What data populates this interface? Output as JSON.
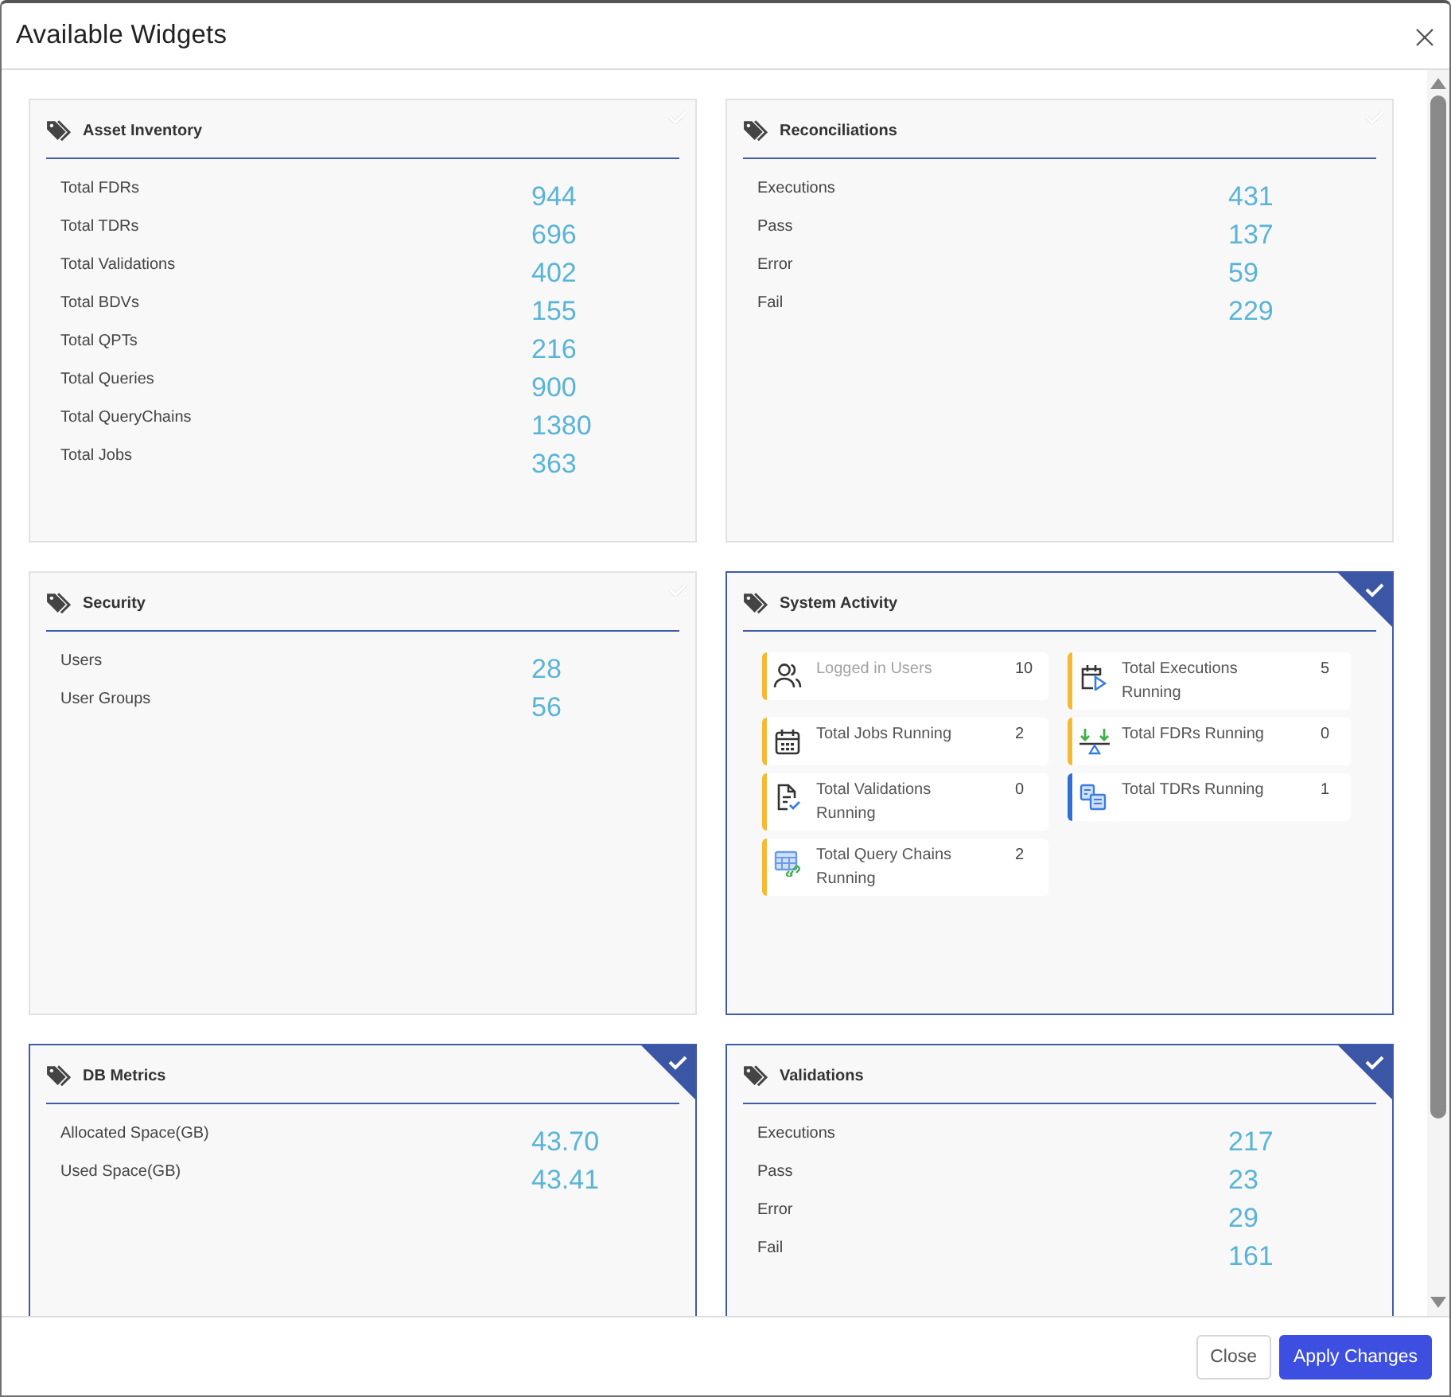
{
  "dialog": {
    "title": "Available Widgets"
  },
  "widgets": [
    {
      "title": "Asset Inventory",
      "selected": false,
      "kind": "stats",
      "rows": [
        {
          "label": "Total FDRs",
          "value": "944"
        },
        {
          "label": "Total TDRs",
          "value": "696"
        },
        {
          "label": "Total Validations",
          "value": "402"
        },
        {
          "label": "Total BDVs",
          "value": "155"
        },
        {
          "label": "Total QPTs",
          "value": "216"
        },
        {
          "label": "Total Queries",
          "value": "900"
        },
        {
          "label": "Total QueryChains",
          "value": "1380"
        },
        {
          "label": "Total Jobs",
          "value": "363"
        }
      ]
    },
    {
      "title": "Reconciliations",
      "selected": false,
      "kind": "stats",
      "rows": [
        {
          "label": "Executions",
          "value": "431"
        },
        {
          "label": "Pass",
          "value": "137"
        },
        {
          "label": "Error",
          "value": "59"
        },
        {
          "label": "Fail",
          "value": "229"
        }
      ]
    },
    {
      "title": "Security",
      "selected": false,
      "kind": "stats",
      "rows": [
        {
          "label": "Users",
          "value": "28"
        },
        {
          "label": "User Groups",
          "value": "56"
        }
      ]
    },
    {
      "title": "System Activity",
      "selected": true,
      "kind": "activity",
      "tiles": [
        {
          "label": "Logged in Users",
          "value": "10",
          "color": "#f5b935",
          "dimmed": true
        },
        {
          "label": "Total Executions Running",
          "value": "5",
          "color": "#f5b935",
          "dimmed": false
        },
        {
          "label": "Total Jobs Running",
          "value": "2",
          "color": "#f5b935",
          "dimmed": false
        },
        {
          "label": "Total FDRs Running",
          "value": "0",
          "color": "#f5b935",
          "dimmed": false
        },
        {
          "label": "Total Validations Running",
          "value": "0",
          "color": "#f5b935",
          "dimmed": false
        },
        {
          "label": "Total TDRs Running",
          "value": "1",
          "color": "#2f6fd6",
          "dimmed": false
        },
        {
          "label": "Total Query Chains Running",
          "value": "2",
          "color": "#f5b935",
          "dimmed": false
        }
      ]
    },
    {
      "title": "DB Metrics",
      "selected": true,
      "kind": "stats",
      "rows": [
        {
          "label": "Allocated Space(GB)",
          "value": "43.70"
        },
        {
          "label": "Used Space(GB)",
          "value": "43.41"
        }
      ]
    },
    {
      "title": "Validations",
      "selected": true,
      "kind": "stats",
      "rows": [
        {
          "label": "Executions",
          "value": "217"
        },
        {
          "label": "Pass",
          "value": "23"
        },
        {
          "label": "Error",
          "value": "29"
        },
        {
          "label": "Fail",
          "value": "161"
        }
      ]
    }
  ],
  "buttons": [
    {
      "label": "Close",
      "kind": "secondary"
    },
    {
      "label": "Apply Changes",
      "kind": "primary"
    }
  ]
}
